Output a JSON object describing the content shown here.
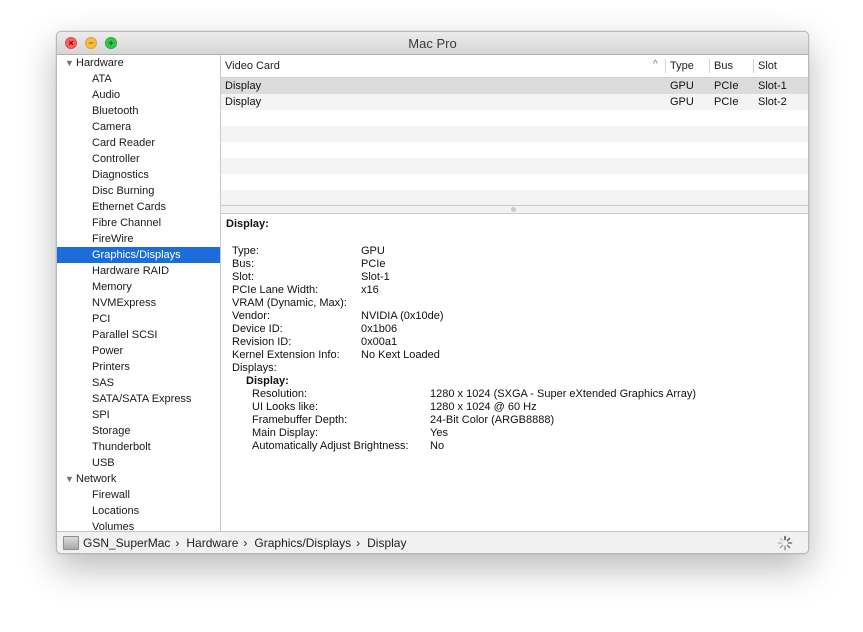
{
  "window": {
    "title": "Mac Pro"
  },
  "sidebar": {
    "items": [
      {
        "label": "Hardware",
        "kind": "group"
      },
      {
        "label": "ATA",
        "kind": "sub"
      },
      {
        "label": "Audio",
        "kind": "sub"
      },
      {
        "label": "Bluetooth",
        "kind": "sub"
      },
      {
        "label": "Camera",
        "kind": "sub"
      },
      {
        "label": "Card Reader",
        "kind": "sub"
      },
      {
        "label": "Controller",
        "kind": "sub"
      },
      {
        "label": "Diagnostics",
        "kind": "sub"
      },
      {
        "label": "Disc Burning",
        "kind": "sub"
      },
      {
        "label": "Ethernet Cards",
        "kind": "sub"
      },
      {
        "label": "Fibre Channel",
        "kind": "sub"
      },
      {
        "label": "FireWire",
        "kind": "sub"
      },
      {
        "label": "Graphics/Displays",
        "kind": "sub",
        "selected": true
      },
      {
        "label": "Hardware RAID",
        "kind": "sub"
      },
      {
        "label": "Memory",
        "kind": "sub"
      },
      {
        "label": "NVMExpress",
        "kind": "sub"
      },
      {
        "label": "PCI",
        "kind": "sub"
      },
      {
        "label": "Parallel SCSI",
        "kind": "sub"
      },
      {
        "label": "Power",
        "kind": "sub"
      },
      {
        "label": "Printers",
        "kind": "sub"
      },
      {
        "label": "SAS",
        "kind": "sub"
      },
      {
        "label": "SATA/SATA Express",
        "kind": "sub"
      },
      {
        "label": "SPI",
        "kind": "sub"
      },
      {
        "label": "Storage",
        "kind": "sub"
      },
      {
        "label": "Thunderbolt",
        "kind": "sub"
      },
      {
        "label": "USB",
        "kind": "sub"
      },
      {
        "label": "Network",
        "kind": "group"
      },
      {
        "label": "Firewall",
        "kind": "sub"
      },
      {
        "label": "Locations",
        "kind": "sub"
      },
      {
        "label": "Volumes",
        "kind": "sub"
      }
    ]
  },
  "table": {
    "columns": [
      "Video Card",
      "Type",
      "Bus",
      "Slot"
    ],
    "rows": [
      [
        "Display",
        "GPU",
        "PCIe",
        "Slot-1"
      ],
      [
        "Display",
        "GPU",
        "PCIe",
        "Slot-2"
      ]
    ]
  },
  "detail": {
    "heading": "Display:",
    "fields": [
      {
        "key": "Type:",
        "value": "GPU"
      },
      {
        "key": "Bus:",
        "value": "PCIe"
      },
      {
        "key": "Slot:",
        "value": "Slot-1"
      },
      {
        "key": "PCIe Lane Width:",
        "value": "x16"
      },
      {
        "key": "VRAM (Dynamic, Max):",
        "value": ""
      },
      {
        "key": "Vendor:",
        "value": "NVIDIA (0x10de)"
      },
      {
        "key": "Device ID:",
        "value": "0x1b06"
      },
      {
        "key": "Revision ID:",
        "value": "0x00a1"
      },
      {
        "key": "Kernel Extension Info:",
        "value": "No Kext Loaded"
      },
      {
        "key": "Displays:",
        "value": ""
      }
    ],
    "sub_heading": "Display:",
    "sub_fields": [
      {
        "key": "Resolution:",
        "value": "1280 x 1024 (SXGA - Super eXtended Graphics Array)"
      },
      {
        "key": "UI Looks like:",
        "value": "1280 x 1024 @ 60 Hz"
      },
      {
        "key": "Framebuffer Depth:",
        "value": "24-Bit Color (ARGB8888)"
      },
      {
        "key": "Main Display:",
        "value": "Yes"
      },
      {
        "key": "Automatically Adjust Brightness:",
        "value": "No"
      }
    ]
  },
  "statusbar": {
    "path": [
      "GSN_SuperMac",
      "Hardware",
      "Graphics/Displays",
      "Display"
    ],
    "separator": "›"
  },
  "colors": {
    "selection": "#1b6ed9",
    "close": "#fc605c",
    "minimize": "#fdbc40",
    "maximize": "#34c84a"
  },
  "icons": [
    "close-icon",
    "minimize-icon",
    "maximize-icon",
    "disclosure-triangle-icon",
    "sort-ascending-icon",
    "hard-drive-icon",
    "spinner-icon"
  ]
}
